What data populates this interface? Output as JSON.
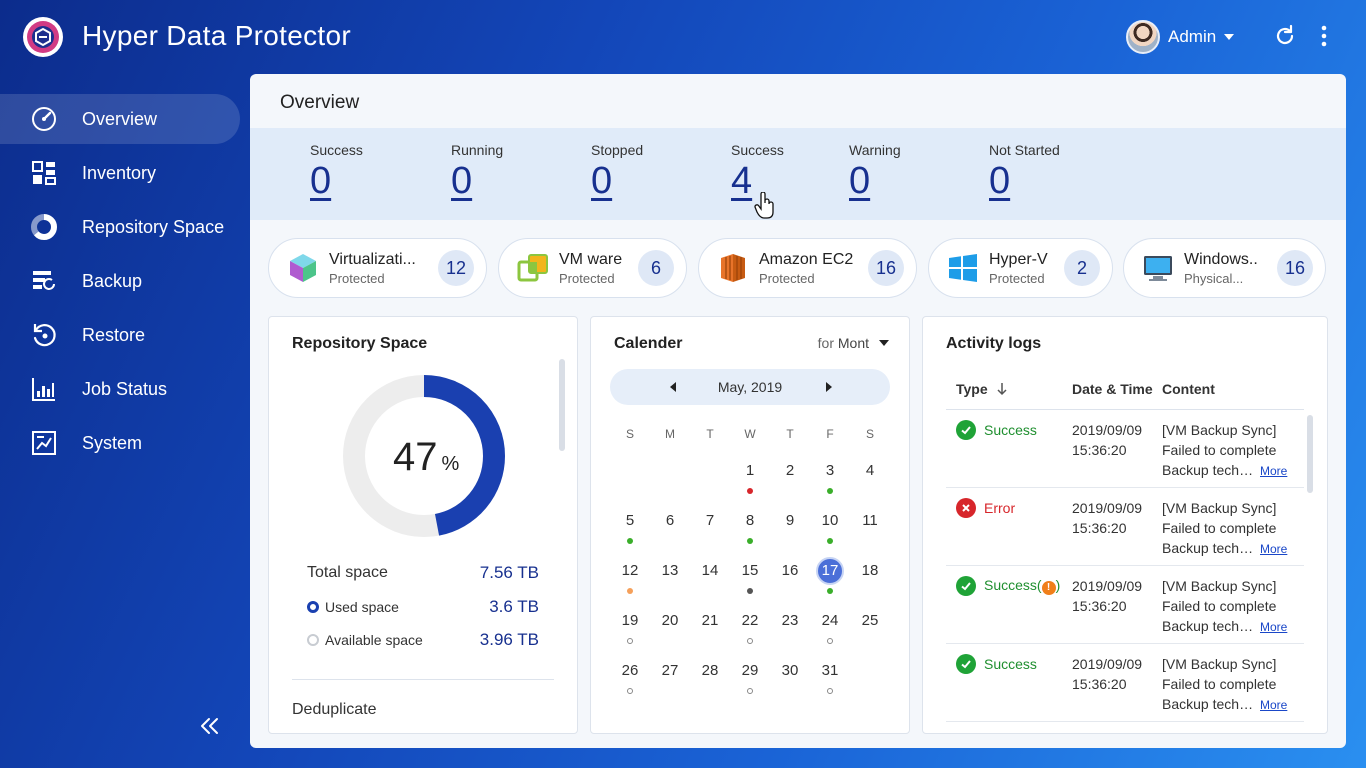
{
  "app": {
    "title": "Hyper Data Protector"
  },
  "header": {
    "user_name": "Admin"
  },
  "sidebar": {
    "items": [
      {
        "label": "Overview",
        "icon": "gauge-icon",
        "active": true
      },
      {
        "label": "Inventory",
        "icon": "grid-icon"
      },
      {
        "label": "Repository Space",
        "icon": "pie-chart-icon"
      },
      {
        "label": "Backup",
        "icon": "backup-icon"
      },
      {
        "label": "Restore",
        "icon": "restore-icon"
      },
      {
        "label": "Job Status",
        "icon": "bar-chart-icon"
      },
      {
        "label": "System",
        "icon": "system-icon"
      }
    ]
  },
  "main": {
    "title": "Overview",
    "stats": [
      {
        "label": "Success",
        "value": "0"
      },
      {
        "label": "Running",
        "value": "0"
      },
      {
        "label": "Stopped",
        "value": "0"
      },
      {
        "label": "Success",
        "value": "4"
      },
      {
        "label": "Warning",
        "value": "0"
      },
      {
        "label": "Not Started",
        "value": "0"
      }
    ],
    "pills": [
      {
        "name": "Virtualizati...",
        "sub": "Protected",
        "count": "12",
        "icon": "virtualization-cube-icon"
      },
      {
        "name": "VM ware",
        "sub": "Protected",
        "count": "6",
        "icon": "vmware-icon"
      },
      {
        "name": "Amazon EC2",
        "sub": "Protected",
        "count": "16",
        "icon": "amazon-ec2-icon"
      },
      {
        "name": "Hyper-V",
        "sub": "Protected",
        "count": "2",
        "icon": "windows-icon"
      },
      {
        "name": "Windows..",
        "sub": "Physical...",
        "count": "16",
        "icon": "monitor-icon"
      }
    ]
  },
  "repository": {
    "title": "Repository Space",
    "percent": "47",
    "percent_unit": "%",
    "used_fraction": 0.47,
    "total_label": "Total space",
    "total_value": "7.56 TB",
    "used_label": "Used space",
    "used_value": "3.6 TB",
    "avail_label": "Available space",
    "avail_value": "3.96 TB",
    "dedup_label": "Deduplicate",
    "colors": {
      "used": "#1a40b0",
      "avail": "#ededed"
    }
  },
  "calendar": {
    "title": "Calender",
    "for_label": "for",
    "for_value": "Mont",
    "month": "May, 2019",
    "weekdays": [
      "S",
      "M",
      "T",
      "W",
      "T",
      "F",
      "S"
    ],
    "first_weekday": 3,
    "days_in_month": 31,
    "today": 17,
    "marks": {
      "1": "error",
      "3": "success",
      "5": "success",
      "8": "success",
      "10": "success",
      "12": "warning",
      "15": "gray",
      "17": "success",
      "19": "empty",
      "22": "empty",
      "24": "empty",
      "26": "empty",
      "29": "empty",
      "31": "empty"
    },
    "mark_colors": {
      "success": "#3aae2a",
      "error": "#d7262b",
      "warning": "#f5a05a",
      "gray": "#555555"
    }
  },
  "activity": {
    "title": "Activity logs",
    "columns": {
      "type": "Type",
      "date": "Date & Time",
      "content": "Content"
    },
    "rows": [
      {
        "type": "Success",
        "status": "success",
        "date": "2019/09/09",
        "time": "15:36:20",
        "line1": "[VM Backup Sync]",
        "line2": "Failed to complete",
        "line3": "Backup techn...",
        "more": "More"
      },
      {
        "type": "Error",
        "status": "error",
        "date": "2019/09/09",
        "time": "15:36:20",
        "line1": "[VM Backup Sync]",
        "line2": "Failed to complete",
        "line3": "Backup techn...",
        "more": "More"
      },
      {
        "type": "Success(",
        "type_suffix": ")",
        "status": "success-warning",
        "date": "2019/09/09",
        "time": "15:36:20",
        "line1": "[VM Backup Sync]",
        "line2": "Failed to complete",
        "line3": "Backup techn...",
        "more": "More"
      },
      {
        "type": "Success",
        "status": "success",
        "date": "2019/09/09",
        "time": "15:36:20",
        "line1": "[VM Backup Sync]",
        "line2": "Failed to complete",
        "line3": "Backup techn...",
        "more": "More"
      }
    ],
    "colors": {
      "success": "#1f8f2f",
      "error": "#d7262b"
    }
  }
}
